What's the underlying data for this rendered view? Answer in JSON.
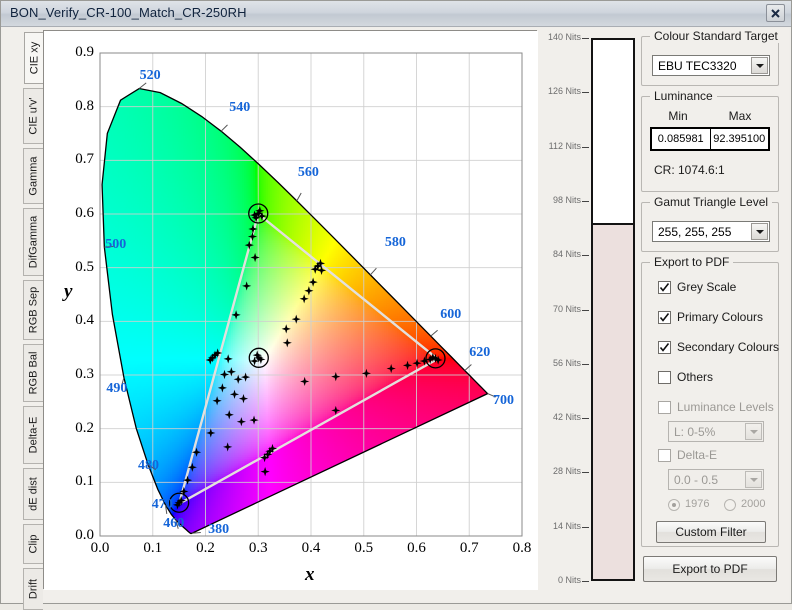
{
  "window": {
    "title": "BON_Verify_CR-100_Match_CR-250RH",
    "close_icon": "close-x-icon"
  },
  "tabs": [
    {
      "label": "CIE xy",
      "active": true
    },
    {
      "label": "CIE u'v'",
      "active": false
    },
    {
      "label": "Gamma",
      "active": false
    },
    {
      "label": "DifGamma",
      "active": false
    },
    {
      "label": "RGB Sep",
      "active": false
    },
    {
      "label": "RGB Bal",
      "active": false
    },
    {
      "label": "Delta-E",
      "active": false
    },
    {
      "label": "dE dist",
      "active": false
    },
    {
      "label": "Clip",
      "active": false
    },
    {
      "label": "Drift",
      "active": false
    }
  ],
  "nits_scale": {
    "labels": [
      "140 Nits",
      "126 Nits",
      "112 Nits",
      "98 Nits",
      "84 Nits",
      "70 Nits",
      "56 Nits",
      "42 Nits",
      "28 Nits",
      "14 Nits",
      "0 Nits"
    ],
    "values": [
      140,
      126,
      112,
      98,
      84,
      70,
      56,
      42,
      28,
      14,
      0
    ],
    "max": 140,
    "fill_value": 92.3951,
    "fill_color": "#ece0de"
  },
  "panel": {
    "colour_standard": {
      "title": "Colour Standard Target",
      "value": "EBU TEC3320"
    },
    "luminance": {
      "title": "Luminance",
      "min_header": "Min",
      "max_header": "Max",
      "min_value": "0.085981",
      "max_value": "92.395100",
      "cr_text": "CR: 1074.6:1"
    },
    "gamut": {
      "title": "Gamut Triangle Level",
      "value": "255, 255, 255"
    },
    "export": {
      "title": "Export to PDF",
      "checks": [
        {
          "label": "Grey Scale",
          "checked": true,
          "enabled": true
        },
        {
          "label": "Primary Colours",
          "checked": true,
          "enabled": true
        },
        {
          "label": "Secondary Colours",
          "checked": true,
          "enabled": true
        },
        {
          "label": "Others",
          "checked": false,
          "enabled": true
        },
        {
          "label": "Luminance Levels",
          "checked": false,
          "enabled": true
        },
        {
          "label": "Delta-E",
          "checked": false,
          "enabled": true
        }
      ],
      "luminance_levels_value": "L:   0-5%",
      "delta_e_value": "0.0 - 0.5",
      "radio_1976": "1976",
      "radio_2000": "2000",
      "radio_selected": "1976",
      "custom_filter_label": "Custom Filter"
    },
    "export_button_label": "Export to PDF"
  },
  "chart_data": {
    "type": "scatter",
    "title": "",
    "xlabel": "x",
    "ylabel": "y",
    "xlim": [
      0.0,
      0.8
    ],
    "ylim": [
      0.0,
      0.9
    ],
    "xticks": [
      "0.0",
      "0.1",
      "0.2",
      "0.3",
      "0.4",
      "0.5",
      "0.6",
      "0.7",
      "0.8"
    ],
    "yticks": [
      "0.0",
      "0.1",
      "0.2",
      "0.3",
      "0.4",
      "0.5",
      "0.6",
      "0.7",
      "0.8",
      "0.9"
    ],
    "grid": true,
    "legend": "none",
    "wavelength_labels": [
      {
        "text": "520",
        "x": 0.075,
        "y": 0.855
      },
      {
        "text": "540",
        "x": 0.245,
        "y": 0.795
      },
      {
        "text": "560",
        "x": 0.375,
        "y": 0.675
      },
      {
        "text": "500",
        "x": 0.01,
        "y": 0.54
      },
      {
        "text": "580",
        "x": 0.54,
        "y": 0.545
      },
      {
        "text": "600",
        "x": 0.645,
        "y": 0.41
      },
      {
        "text": "620",
        "x": 0.7,
        "y": 0.34
      },
      {
        "text": "700",
        "x": 0.745,
        "y": 0.25
      },
      {
        "text": "490",
        "x": 0.012,
        "y": 0.272
      },
      {
        "text": "480",
        "x": 0.072,
        "y": 0.128
      },
      {
        "text": "470",
        "x": 0.098,
        "y": 0.055
      },
      {
        "text": "460",
        "x": 0.12,
        "y": 0.02
      },
      {
        "text": "380",
        "x": 0.205,
        "y": 0.01
      }
    ],
    "gamut_triangle": {
      "colour": "#e3e0dd",
      "vertices": [
        {
          "name": "red",
          "x": 0.64,
          "y": 0.33
        },
        {
          "name": "green",
          "x": 0.3,
          "y": 0.6
        },
        {
          "name": "blue",
          "x": 0.15,
          "y": 0.06
        }
      ]
    },
    "measured_points": [
      {
        "x": 0.3,
        "y": 0.601,
        "circled": true
      },
      {
        "x": 0.296,
        "y": 0.593,
        "circled": false
      },
      {
        "x": 0.303,
        "y": 0.606,
        "circled": false
      },
      {
        "x": 0.293,
        "y": 0.598,
        "circled": false
      },
      {
        "x": 0.307,
        "y": 0.596,
        "circled": false
      },
      {
        "x": 0.29,
        "y": 0.572,
        "circled": false
      },
      {
        "x": 0.289,
        "y": 0.558,
        "circled": false
      },
      {
        "x": 0.283,
        "y": 0.542,
        "circled": false
      },
      {
        "x": 0.294,
        "y": 0.519,
        "circled": false
      },
      {
        "x": 0.278,
        "y": 0.466,
        "circled": false
      },
      {
        "x": 0.258,
        "y": 0.412,
        "circled": false
      },
      {
        "x": 0.413,
        "y": 0.503,
        "circled": false
      },
      {
        "x": 0.418,
        "y": 0.508,
        "circled": false
      },
      {
        "x": 0.408,
        "y": 0.497,
        "circled": false
      },
      {
        "x": 0.42,
        "y": 0.495,
        "circled": false
      },
      {
        "x": 0.404,
        "y": 0.473,
        "circled": false
      },
      {
        "x": 0.396,
        "y": 0.457,
        "circled": false
      },
      {
        "x": 0.387,
        "y": 0.442,
        "circled": false
      },
      {
        "x": 0.372,
        "y": 0.404,
        "circled": false
      },
      {
        "x": 0.355,
        "y": 0.36,
        "circled": false
      },
      {
        "x": 0.301,
        "y": 0.332,
        "circled": true
      },
      {
        "x": 0.298,
        "y": 0.337,
        "circled": false
      },
      {
        "x": 0.305,
        "y": 0.329,
        "circled": false
      },
      {
        "x": 0.293,
        "y": 0.326,
        "circled": false
      },
      {
        "x": 0.218,
        "y": 0.337,
        "circled": false
      },
      {
        "x": 0.213,
        "y": 0.332,
        "circled": false
      },
      {
        "x": 0.223,
        "y": 0.341,
        "circled": false
      },
      {
        "x": 0.209,
        "y": 0.328,
        "circled": false
      },
      {
        "x": 0.243,
        "y": 0.33,
        "circled": false
      },
      {
        "x": 0.249,
        "y": 0.306,
        "circled": false
      },
      {
        "x": 0.236,
        "y": 0.301,
        "circled": false
      },
      {
        "x": 0.262,
        "y": 0.292,
        "circled": false
      },
      {
        "x": 0.276,
        "y": 0.296,
        "circled": false
      },
      {
        "x": 0.232,
        "y": 0.276,
        "circled": false
      },
      {
        "x": 0.255,
        "y": 0.264,
        "circled": false
      },
      {
        "x": 0.272,
        "y": 0.256,
        "circled": false
      },
      {
        "x": 0.222,
        "y": 0.252,
        "circled": false
      },
      {
        "x": 0.245,
        "y": 0.226,
        "circled": false
      },
      {
        "x": 0.268,
        "y": 0.213,
        "circled": false
      },
      {
        "x": 0.292,
        "y": 0.216,
        "circled": false
      },
      {
        "x": 0.21,
        "y": 0.192,
        "circled": false
      },
      {
        "x": 0.242,
        "y": 0.166,
        "circled": false
      },
      {
        "x": 0.322,
        "y": 0.158,
        "circled": false
      },
      {
        "x": 0.318,
        "y": 0.152,
        "circled": false
      },
      {
        "x": 0.327,
        "y": 0.163,
        "circled": false
      },
      {
        "x": 0.312,
        "y": 0.146,
        "circled": false
      },
      {
        "x": 0.313,
        "y": 0.12,
        "circled": false
      },
      {
        "x": 0.15,
        "y": 0.062,
        "circled": true
      },
      {
        "x": 0.147,
        "y": 0.058,
        "circled": false
      },
      {
        "x": 0.154,
        "y": 0.066,
        "circled": false
      },
      {
        "x": 0.159,
        "y": 0.083,
        "circled": false
      },
      {
        "x": 0.166,
        "y": 0.104,
        "circled": false
      },
      {
        "x": 0.175,
        "y": 0.128,
        "circled": false
      },
      {
        "x": 0.183,
        "y": 0.156,
        "circled": false
      },
      {
        "x": 0.636,
        "y": 0.331,
        "circled": true
      },
      {
        "x": 0.631,
        "y": 0.333,
        "circled": false
      },
      {
        "x": 0.641,
        "y": 0.328,
        "circled": false
      },
      {
        "x": 0.626,
        "y": 0.329,
        "circled": false
      },
      {
        "x": 0.615,
        "y": 0.326,
        "circled": false
      },
      {
        "x": 0.601,
        "y": 0.322,
        "circled": false
      },
      {
        "x": 0.583,
        "y": 0.318,
        "circled": false
      },
      {
        "x": 0.552,
        "y": 0.312,
        "circled": false
      },
      {
        "x": 0.505,
        "y": 0.303,
        "circled": false
      },
      {
        "x": 0.447,
        "y": 0.297,
        "circled": false
      },
      {
        "x": 0.388,
        "y": 0.288,
        "circled": false
      },
      {
        "x": 0.447,
        "y": 0.234,
        "circled": false
      },
      {
        "x": 0.353,
        "y": 0.386,
        "circled": false
      }
    ]
  }
}
